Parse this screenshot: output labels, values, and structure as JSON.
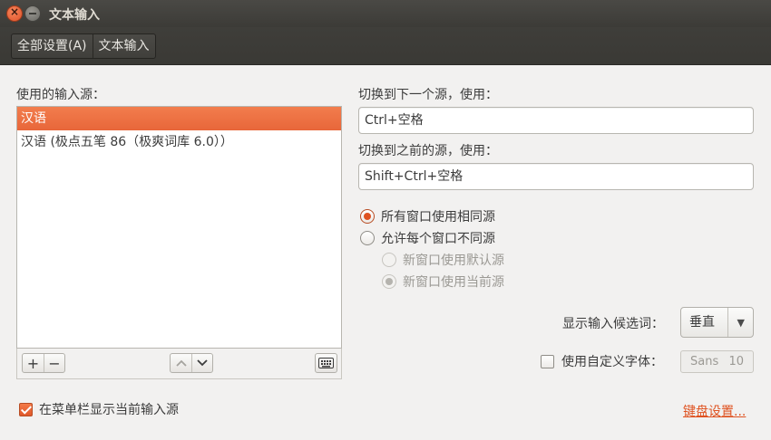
{
  "window": {
    "title": "文本输入",
    "close_glyph": "×"
  },
  "toolbar": {
    "breadcrumbs": [
      "全部设置(A)",
      "文本输入"
    ]
  },
  "sources": {
    "label": "使用的输入源：",
    "items": [
      "汉语",
      "汉语 (极点五笔 86（极爽词库 6.0））"
    ],
    "selected_index": 0,
    "buttons": {
      "add": "+",
      "remove": "−",
      "up": "∧",
      "down": "∨",
      "keyboard": "⌨"
    }
  },
  "next_source": {
    "label": "切换到下一个源，使用：",
    "value": "Ctrl+空格"
  },
  "prev_source": {
    "label": "切换到之前的源，使用：",
    "value": "Shift+Ctrl+空格"
  },
  "window_mode": {
    "options": [
      {
        "label": "所有窗口使用相同源",
        "checked": true,
        "enabled": true
      },
      {
        "label": "允许每个窗口不同源",
        "checked": false,
        "enabled": true
      },
      {
        "label": "新窗口使用默认源",
        "checked": false,
        "enabled": false
      },
      {
        "label": "新窗口使用当前源",
        "checked": true,
        "enabled": false
      }
    ]
  },
  "candidates": {
    "label": "显示输入候选词：",
    "value": "垂直",
    "arrow": "▼"
  },
  "custom_font": {
    "label": "使用自定义字体：",
    "checked": false,
    "font_name": "Sans",
    "font_size": "10"
  },
  "show_in_menubar": {
    "label": "在菜单栏显示当前输入源",
    "checked": true
  },
  "keyboard_settings_link": "键盘设置...",
  "colors": {
    "accent": "#df5220",
    "selection": "#e8663a",
    "titlebar": "#3c3b37",
    "background": "#f2f1f0"
  },
  "icons": {
    "close": "close-icon",
    "minimize": "minimize-icon",
    "keyboard": "keyboard-icon",
    "dropdown": "chevron-down-icon"
  }
}
